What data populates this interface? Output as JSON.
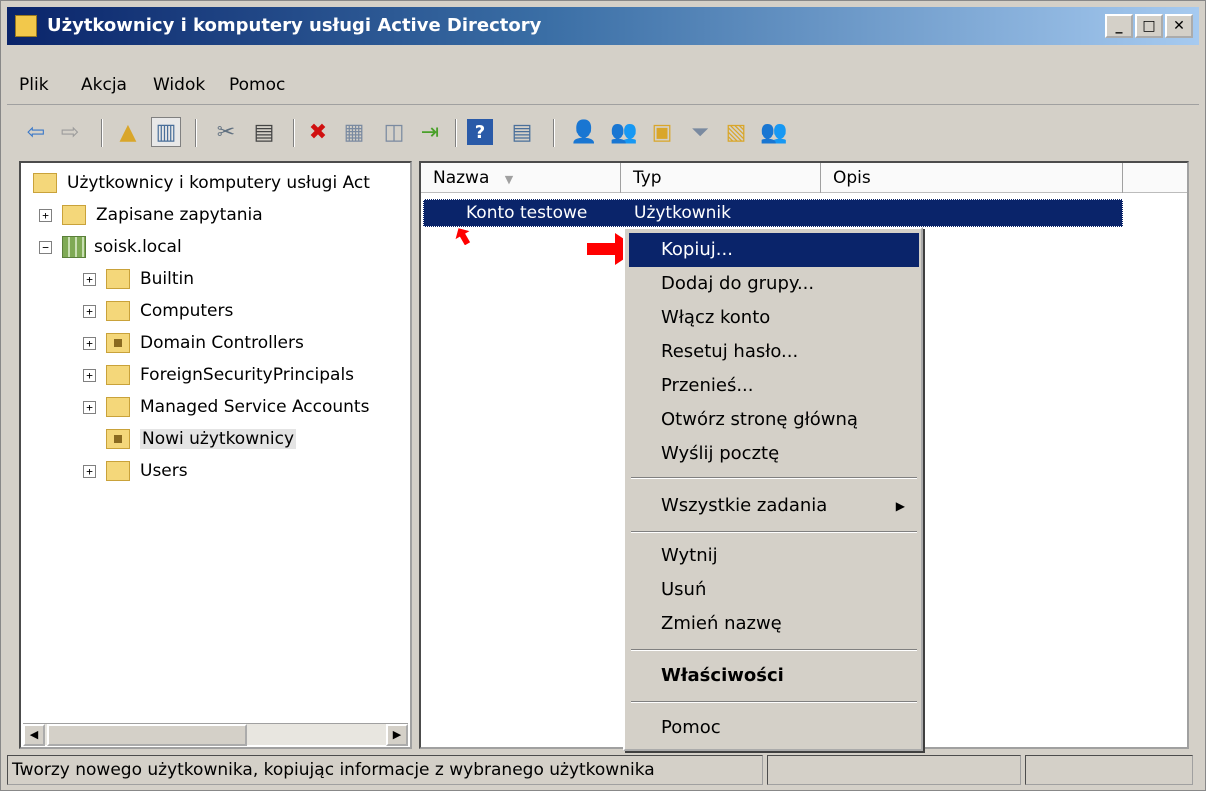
{
  "window": {
    "title": "Użytkownicy i komputery usługi Active Directory"
  },
  "menu": [
    "Plik",
    "Akcja",
    "Widok",
    "Pomoc"
  ],
  "tree": {
    "root": "Użytkownicy i komputery usługi Act",
    "saved_queries": "Zapisane zapytania",
    "domain": "soisk.local",
    "children": [
      "Builtin",
      "Computers",
      "Domain Controllers",
      "ForeignSecurityPrincipals",
      "Managed Service Accounts",
      "Nowi użytkownicy",
      "Users"
    ]
  },
  "list": {
    "columns": [
      "Nazwa",
      "Typ",
      "Opis"
    ],
    "rows": [
      {
        "name": "Konto testowe",
        "type": "Użytkownik",
        "description": ""
      }
    ]
  },
  "context_menu": {
    "items": [
      "Kopiuj...",
      "Dodaj do grupy...",
      "Włącz konto",
      "Resetuj hasło...",
      "Przenieś...",
      "Otwórz stronę główną",
      "Wyślij pocztę",
      "Wszystkie zadania",
      "Wytnij",
      "Usuń",
      "Zmień nazwę",
      "Właściwości",
      "Pomoc"
    ],
    "highlighted": "Kopiuj..."
  },
  "status": {
    "text": "Tworzy nowego użytkownika, kopiując informacje z wybranego użytkownika"
  },
  "colors": {
    "selection": "#0a246a",
    "title_gradient_start": "#0a246a",
    "annotation_arrow": "#ff0000"
  }
}
